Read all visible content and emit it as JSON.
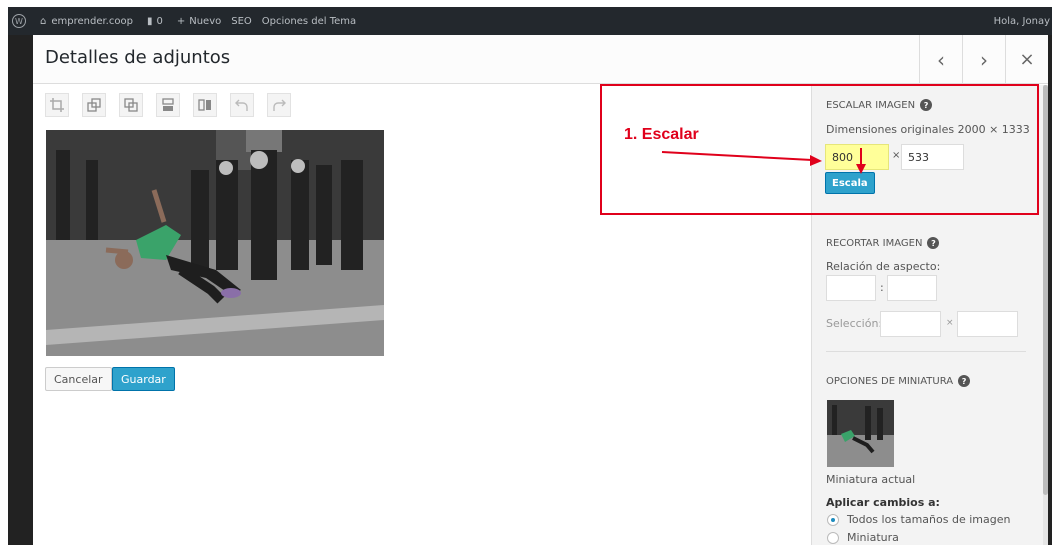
{
  "adminbar": {
    "site": "emprender.coop",
    "comments": "0",
    "new_label": "Nuevo",
    "seo_label": "SEO",
    "theme_options_label": "Opciones del Tema",
    "greeting": "Hola, Jonay"
  },
  "modal": {
    "title": "Detalles de adjuntos",
    "prev_icon": "‹",
    "next_icon": "›",
    "close_icon": "×"
  },
  "editor": {
    "cancel_label": "Cancelar",
    "save_label": "Guardar"
  },
  "sidebar": {
    "scale": {
      "title": "ESCALAR IMAGEN",
      "original_dims": "Dimensiones originales 2000 × 1333",
      "width": "800",
      "times": "×",
      "height": "533",
      "button": "Escala"
    },
    "crop": {
      "title": "RECORTAR IMAGEN",
      "aspect_label": "Relación de aspecto:",
      "colon": ":",
      "selection_label": "Selección:",
      "times": "×"
    },
    "thumb": {
      "title": "OPCIONES DE MINIATURA",
      "current_label": "Miniatura actual",
      "apply_label": "Aplicar cambios a:",
      "options": [
        "Todos los tamaños de imagen",
        "Miniatura"
      ]
    }
  },
  "annotation": {
    "label": "1. Escalar",
    "color": "#e0001b"
  },
  "colors": {
    "adminbar": "#23282d",
    "primary_button": "#2ea2cc",
    "highlight": "#ffff99"
  }
}
